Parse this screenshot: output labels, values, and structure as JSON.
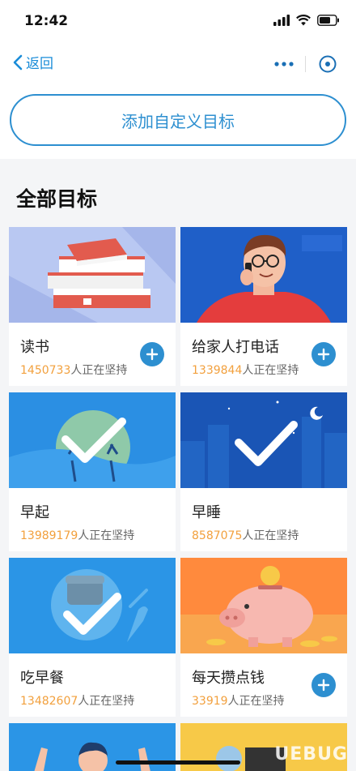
{
  "status": {
    "time": "12:42"
  },
  "nav": {
    "back_label": "返回"
  },
  "add_goal_label": "添加自定义目标",
  "section_title": "全部目标",
  "persisting_suffix": "人正在坚持",
  "goals": [
    {
      "title": "读书",
      "count": "1450733",
      "added": false
    },
    {
      "title": "给家人打电话",
      "count": "1339844",
      "added": false
    },
    {
      "title": "早起",
      "count": "13989179",
      "added": true
    },
    {
      "title": "早睡",
      "count": "8587075",
      "added": true
    },
    {
      "title": "吃早餐",
      "count": "13482607",
      "added": true
    },
    {
      "title": "每天攒点钱",
      "count": "33919",
      "added": false
    }
  ],
  "watermark": "UEBUG",
  "colors": {
    "accent": "#2d8fd0",
    "count": "#f2a03d"
  }
}
